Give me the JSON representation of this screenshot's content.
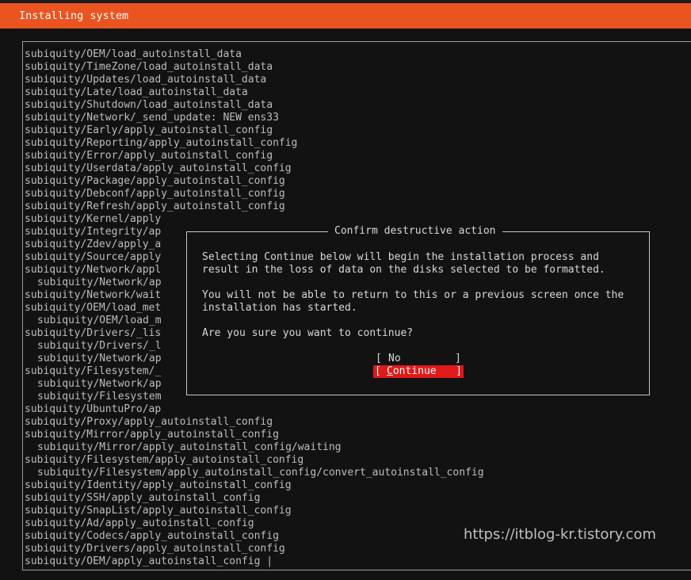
{
  "window": {
    "title": "Installing system"
  },
  "log_lines": [
    {
      "text": "subiquity/OEM/load_autoinstall_data",
      "indent": false
    },
    {
      "text": "subiquity/TimeZone/load_autoinstall_data",
      "indent": false
    },
    {
      "text": "subiquity/Updates/load_autoinstall_data",
      "indent": false
    },
    {
      "text": "subiquity/Late/load_autoinstall_data",
      "indent": false
    },
    {
      "text": "subiquity/Shutdown/load_autoinstall_data",
      "indent": false
    },
    {
      "text": "subiquity/Network/_send_update: NEW ens33",
      "indent": false
    },
    {
      "text": "subiquity/Early/apply_autoinstall_config",
      "indent": false
    },
    {
      "text": "subiquity/Reporting/apply_autoinstall_config",
      "indent": false
    },
    {
      "text": "subiquity/Error/apply_autoinstall_config",
      "indent": false
    },
    {
      "text": "subiquity/Userdata/apply_autoinstall_config",
      "indent": false
    },
    {
      "text": "subiquity/Package/apply_autoinstall_config",
      "indent": false
    },
    {
      "text": "subiquity/Debconf/apply_autoinstall_config",
      "indent": false
    },
    {
      "text": "subiquity/Refresh/apply_autoinstall_config",
      "indent": false
    },
    {
      "text": "subiquity/Kernel/apply",
      "indent": false
    },
    {
      "text": "subiquity/Integrity/ap",
      "indent": false
    },
    {
      "text": "subiquity/Zdev/apply_a",
      "indent": false
    },
    {
      "text": "subiquity/Source/apply",
      "indent": false
    },
    {
      "text": "subiquity/Network/appl",
      "indent": false
    },
    {
      "text": "subiquity/Network/ap",
      "indent": true
    },
    {
      "text": "subiquity/Network/wait",
      "indent": false
    },
    {
      "text": "subiquity/OEM/load_met",
      "indent": false
    },
    {
      "text": "subiquity/OEM/load_m",
      "indent": true
    },
    {
      "text": "subiquity/Drivers/_lis",
      "indent": false
    },
    {
      "text": "subiquity/Drivers/_l",
      "indent": true
    },
    {
      "text": "subiquity/Network/ap",
      "indent": true
    },
    {
      "text": "subiquity/Filesystem/_",
      "indent": false
    },
    {
      "text": "subiquity/Network/ap",
      "indent": true
    },
    {
      "text": "subiquity/Filesystem",
      "indent": true
    },
    {
      "text": "subiquity/UbuntuPro/ap",
      "indent": false
    },
    {
      "text": "subiquity/Proxy/apply_autoinstall_config",
      "indent": false
    },
    {
      "text": "subiquity/Mirror/apply_autoinstall_config",
      "indent": false
    },
    {
      "text": "subiquity/Mirror/apply_autoinstall_config/waiting",
      "indent": true
    },
    {
      "text": "subiquity/Filesystem/apply_autoinstall_config",
      "indent": false
    },
    {
      "text": "subiquity/Filesystem/apply_autoinstall_config/convert_autoinstall_config",
      "indent": true
    },
    {
      "text": "subiquity/Identity/apply_autoinstall_config",
      "indent": false
    },
    {
      "text": "subiquity/SSH/apply_autoinstall_config",
      "indent": false
    },
    {
      "text": "subiquity/SnapList/apply_autoinstall_config",
      "indent": false
    },
    {
      "text": "subiquity/Ad/apply_autoinstall_config",
      "indent": false
    },
    {
      "text": "subiquity/Codecs/apply_autoinstall_config",
      "indent": false
    },
    {
      "text": "subiquity/Drivers/apply_autoinstall_config",
      "indent": false
    },
    {
      "text": "subiquity/OEM/apply_autoinstall_config |",
      "indent": false
    }
  ],
  "dialog": {
    "title": "Confirm destructive action",
    "paragraph1_line1": "Selecting Continue below will begin the installation process and",
    "paragraph1_line2": "result in the loss of data on the disks selected to be formatted.",
    "paragraph2_line1": "You will not be able to return to this or a previous screen once the",
    "paragraph2_line2": "installation has started.",
    "question": "Are you sure you want to continue?",
    "buttons": {
      "no_label": "No",
      "continue_first": "C",
      "continue_rest": "ontinue",
      "bracket_left": "[",
      "bracket_right": "]"
    }
  },
  "watermark": "https://itblog-kr.tistory.com",
  "colors": {
    "titlebar": "#e95420",
    "selected_button": "#e01919",
    "background": "#121212"
  }
}
